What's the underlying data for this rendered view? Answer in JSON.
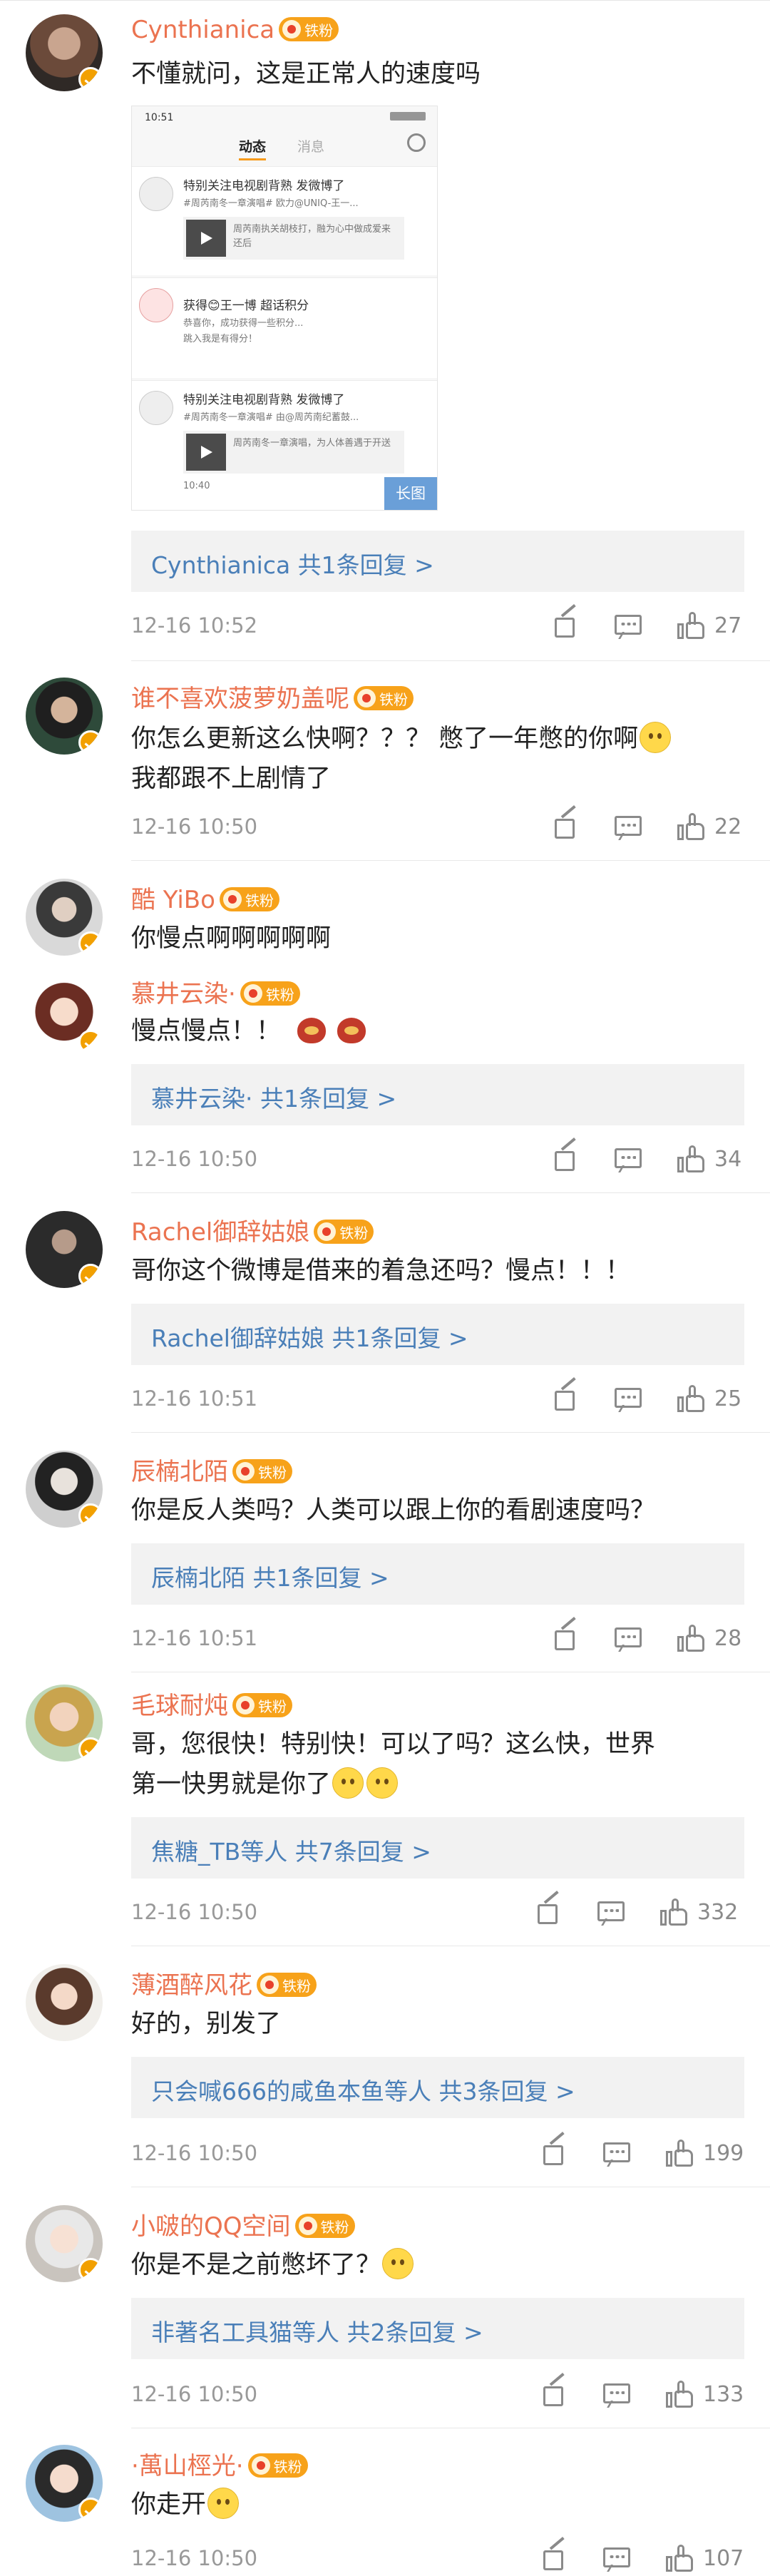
{
  "fan_badge_label": "铁粉",
  "comments": [
    {
      "username": "Cynthianica",
      "text": "不懂就问，这是正常人的速度吗",
      "image_preview": {
        "status_time": "10:51",
        "tab_active": "动态",
        "tab_inactive": "消息",
        "row1_title": "特别关注电视剧背熟 发微博了",
        "row1_sub": "#周芮南冬一章演唱# 欧力@UNIQ-王一...",
        "row1_card": "周芮南执关胡枝打，融为心中做成爱来还后",
        "row2_title": "获得😊王一博 超话积分",
        "row2_sub": "恭喜你，成功获得一些积分...",
        "row2_sub2": "跳入我是有得分！",
        "row3_title": "特别关注电视剧背熟 发微博了",
        "row3_sub": "#周芮南冬一章演唱# 由@周芮南纪蓄鼓...",
        "row3_card": "周芮南冬一章演唱，为人体善遇于开送",
        "row3_time": "10:40",
        "long_image_label": "长图"
      },
      "reply_summary": "Cynthianica  共1条回复 >",
      "time": "12-16 10:52",
      "likes": "27"
    },
    {
      "username": "谁不喜欢菠萝奶盖呢",
      "text_line1": "你怎么更新这么快啊？？？ 憋了一年憋的你啊",
      "text_line2": "我都跟不上剧情了",
      "time": "12-16 10:50",
      "likes": "22"
    },
    {
      "username": "酷 YiBo",
      "text": "你慢点啊啊啊啊啊"
    },
    {
      "username": "慕井云染·",
      "text": "慢点慢点！！",
      "reply_summary": "慕井云染·  共1条回复 >",
      "time": "12-16 10:50",
      "likes": "34"
    },
    {
      "username": "Rachel御辞姑娘",
      "text": "哥你这个微博是借来的着急还吗？慢点！！！",
      "reply_summary": "Rachel御辞姑娘  共1条回复 >",
      "time": "12-16 10:51",
      "likes": "25"
    },
    {
      "username": "辰楠北陌",
      "text": "你是反人类吗？人类可以跟上你的看剧速度吗？",
      "reply_summary": "辰楠北陌  共1条回复 >",
      "time": "12-16 10:51",
      "likes": "28"
    },
    {
      "username": "毛球耐炖",
      "text_line1": "哥，您很快！特别快！可以了吗？这么快，世界",
      "text_line2": "第一快男就是你了",
      "reply_summary": "焦糖_TB等人  共7条回复 >",
      "time": "12-16 10:50",
      "likes": "332"
    },
    {
      "username": "薄酒醉风花",
      "text": "好的，别发了",
      "reply_summary": "只会喊666的咸鱼本鱼等人  共3条回复 >",
      "time": "12-16 10:50",
      "likes": "199"
    },
    {
      "username": "小啵的QQ空间",
      "text": "你是不是之前憋坏了？",
      "reply_summary": "非著名工具猫等人  共2条回复 >",
      "time": "12-16 10:50",
      "likes": "133"
    },
    {
      "username": "·萬山桱光·",
      "text": "你走开",
      "time": "12-16 10:50",
      "likes": "107"
    }
  ]
}
